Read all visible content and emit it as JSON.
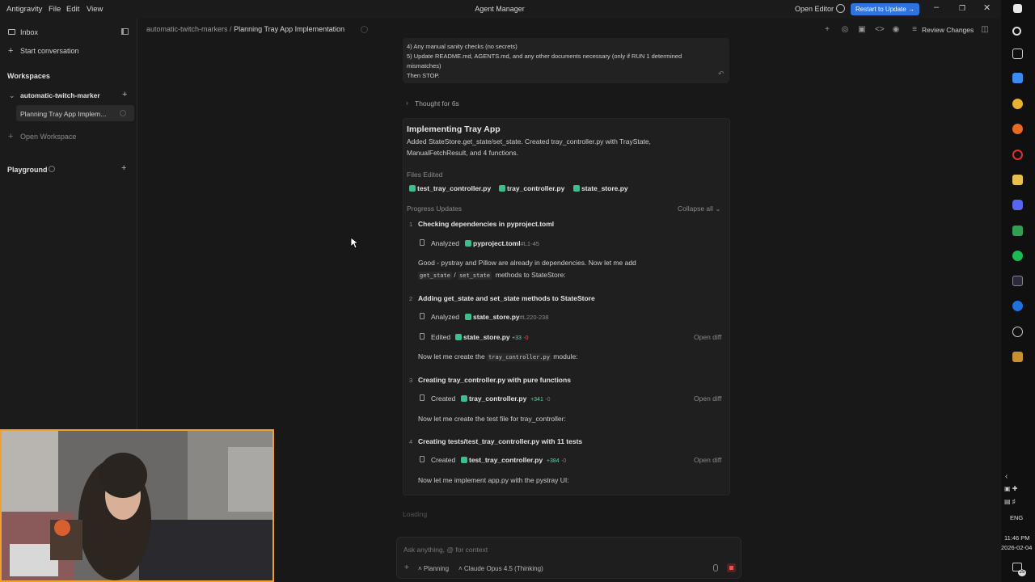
{
  "titlebar": {
    "menu": [
      "Antigravity",
      "File",
      "Edit",
      "View"
    ],
    "title": "Agent Manager",
    "open_editor": "Open Editor",
    "restart": "Restart to Update →"
  },
  "sidebar": {
    "inbox": "Inbox",
    "start_conversation": "Start conversation",
    "workspaces_label": "Workspaces",
    "workspace_name": "automatic-twitch-marker",
    "conversation": "Planning Tray App Implem...",
    "open_workspace": "Open Workspace",
    "playground": "Playground"
  },
  "breadcrumb": {
    "workspace": "automatic-twitch-markers",
    "separator": "/",
    "page": "Planning Tray App Implementation"
  },
  "toolbar": {
    "review_changes": "Review Changes"
  },
  "user_message": {
    "lines": [
      "4) Any manual sanity checks (no secrets)",
      "5) Update README.md, AGENTS.md, and any other documents necessary (only if RUN 1 determined",
      "mismatches)",
      "Then STOP."
    ]
  },
  "thought": "Thought for 6s",
  "task": {
    "title": "Implementing Tray App",
    "summary_1": "Added StateStore.get_state/set_state. Created tray_controller.py with TrayState,",
    "summary_2": "ManualFetchResult, and 4 functions.",
    "files_edited_label": "Files Edited",
    "files": [
      "test_tray_controller.py",
      "tray_controller.py",
      "state_store.py"
    ],
    "progress_label": "Progress Updates",
    "collapse_all": "Collapse all"
  },
  "steps": [
    {
      "num": "1",
      "title": "Checking dependencies in pyproject.toml",
      "action": "Analyzed",
      "file": "pyproject.toml",
      "range": "#L1-45",
      "note_1": "Good - pystray and Pillow are already in dependencies. Now let me add",
      "code_a": "get_state",
      "slash": "/",
      "code_b": "set_state",
      "note_2": "methods to StateStore:"
    },
    {
      "num": "2",
      "title": "Adding get_state and set_state methods to StateStore",
      "action": "Analyzed",
      "file": "state_store.py",
      "range": "#L220-238",
      "action2": "Edited",
      "file2": "state_store.py",
      "add2": "+33",
      "del2": "-0",
      "diff": "Open diff",
      "note_pre": "Now let me create the",
      "code": "tray_controller.py",
      "note_post": "module:"
    },
    {
      "num": "3",
      "title": "Creating tray_controller.py with pure functions",
      "action": "Created",
      "file": "tray_controller.py",
      "add": "+341",
      "del": "-0",
      "diff": "Open diff",
      "note": "Now let me create the test file for tray_controller:"
    },
    {
      "num": "4",
      "title": "Creating tests/test_tray_controller.py with 11 tests",
      "action": "Created",
      "file": "test_tray_controller.py",
      "add": "+384",
      "del": "-0",
      "diff": "Open diff",
      "note": "Now let me implement app.py with the pystray UI:"
    }
  ],
  "loading": "Loading",
  "input": {
    "placeholder": "Ask anything, @ for context",
    "mode": "Planning",
    "model": "Claude Opus 4.5 (Thinking)"
  },
  "taskbar": {
    "lang": "ENG",
    "time": "11:46 PM",
    "date": "2026-02-04",
    "badge": "25"
  },
  "colors": {
    "accent": "#2f73e0",
    "python_icon": "#3cbf8c",
    "added": "#5bd6a0",
    "deleted": "#e05555",
    "webcam_border": "#f0a030"
  }
}
